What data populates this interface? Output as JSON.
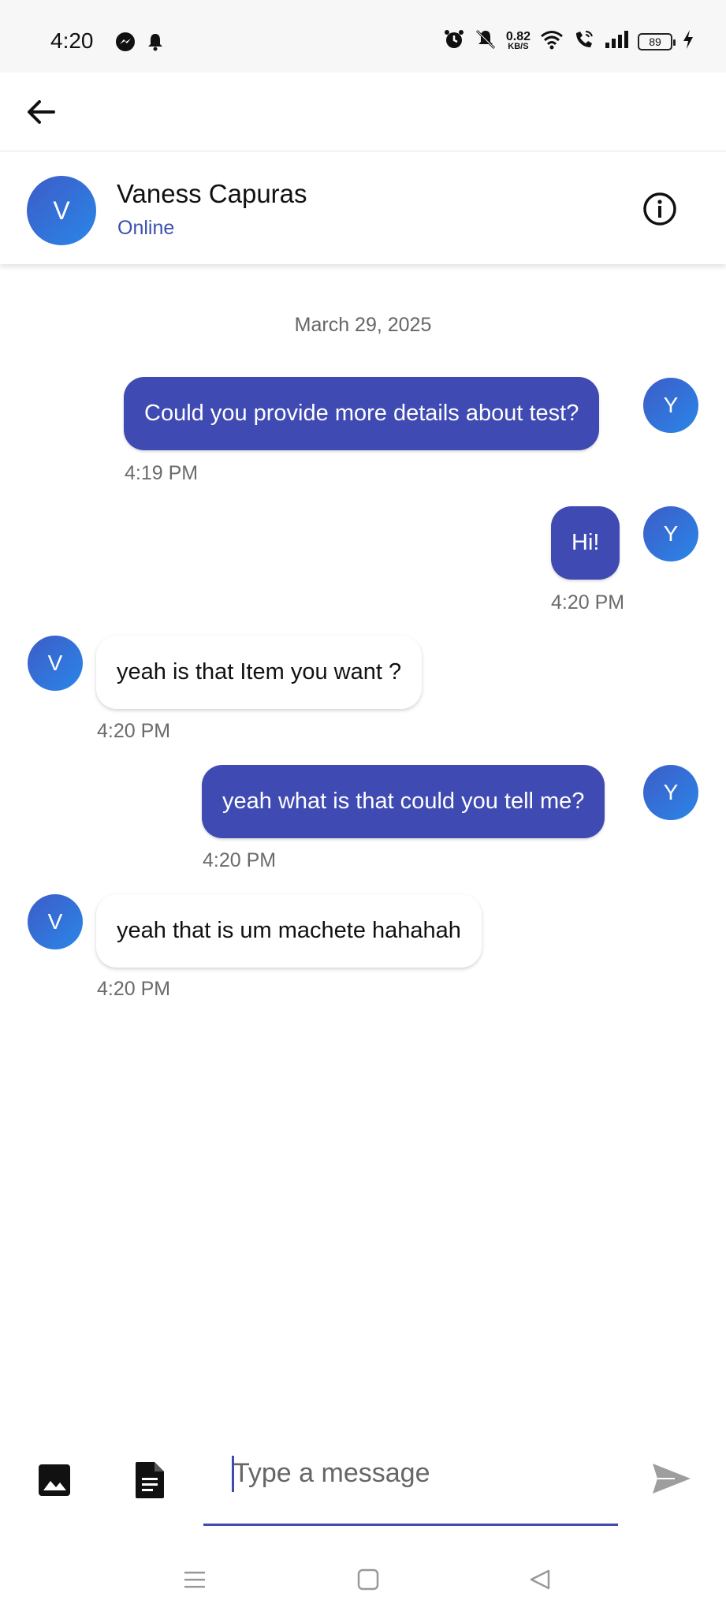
{
  "status_bar": {
    "time": "4:20",
    "net_speed_value": "0.82",
    "net_speed_unit": "KB/S",
    "battery": "89"
  },
  "contact": {
    "avatar_letter": "V",
    "name": "Vaness Capuras",
    "status": "Online"
  },
  "chat": {
    "date": "March 29, 2025",
    "messages": [
      {
        "direction": "outgoing",
        "text": "Could you provide more details about test?",
        "time": "4:19 PM",
        "avatar": "Y"
      },
      {
        "direction": "outgoing",
        "text": "Hi!",
        "time": "4:20 PM",
        "avatar": "Y"
      },
      {
        "direction": "incoming",
        "text": "yeah is that Item you want ?",
        "time": "4:20 PM",
        "avatar": "V"
      },
      {
        "direction": "outgoing",
        "text": "yeah what is that could you tell me?",
        "time": "4:20 PM",
        "avatar": "Y"
      },
      {
        "direction": "incoming",
        "text": "yeah that is um machete hahahah",
        "time": "4:20 PM",
        "avatar": "V"
      }
    ]
  },
  "composer": {
    "placeholder": "Type a message"
  },
  "icons": {
    "back": "arrow-back-icon",
    "info": "info-icon",
    "image": "image-icon",
    "document": "document-icon",
    "send": "send-icon"
  },
  "colors": {
    "accent": "#3f4bb3",
    "avatar": "#2f6fd6",
    "status_online": "#3a4fb0"
  }
}
